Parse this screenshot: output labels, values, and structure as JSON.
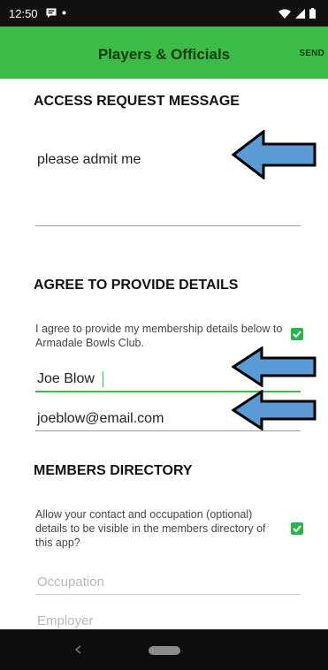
{
  "status_bar": {
    "time": "12:50",
    "left_icons": [
      "message-icon",
      "dot-icon"
    ],
    "right_icons": [
      "wifi-icon",
      "signal-icon",
      "battery-icon"
    ]
  },
  "app_bar": {
    "title": "Players & Officials",
    "send_label": "SEND",
    "color": "#3cbc46"
  },
  "access_request": {
    "heading": "ACCESS REQUEST MESSAGE",
    "message": "please admit me"
  },
  "agree": {
    "heading": "AGREE TO PROVIDE DETAILS",
    "consent_text": "I agree to provide my membership details below to Armadale Bowls Club.",
    "consent_checked": true,
    "name_value": "Joe Blow",
    "email_value": "joeblow@email.com"
  },
  "directory": {
    "heading": "MEMBERS DIRECTORY",
    "visibility_text": "Allow your contact and occupation (optional) details to be visible in the members directory of this app?",
    "visibility_checked": true,
    "occupation_placeholder": "Occupation",
    "employer_placeholder": "Employer"
  },
  "annotations": {
    "arrow_color": "#5b9bd5",
    "arrow_icon": "left-arrow-icon"
  },
  "nav_bar": {
    "icons": [
      "back-icon",
      "home-pill-icon"
    ]
  }
}
